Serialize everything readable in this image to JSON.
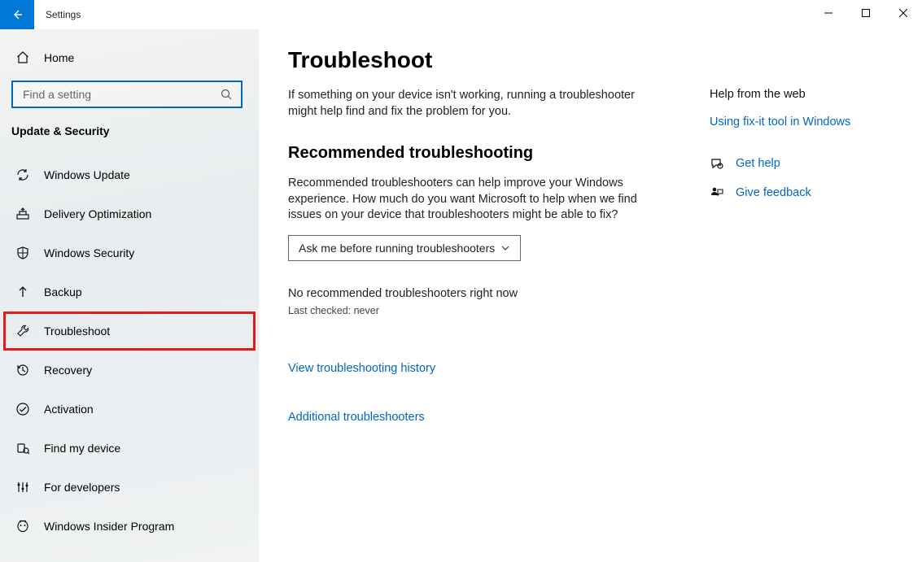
{
  "titlebar": {
    "title": "Settings"
  },
  "sidebar": {
    "home_label": "Home",
    "search_placeholder": "Find a setting",
    "category": "Update & Security",
    "items": [
      {
        "label": "Windows Update"
      },
      {
        "label": "Delivery Optimization"
      },
      {
        "label": "Windows Security"
      },
      {
        "label": "Backup"
      },
      {
        "label": "Troubleshoot"
      },
      {
        "label": "Recovery"
      },
      {
        "label": "Activation"
      },
      {
        "label": "Find my device"
      },
      {
        "label": "For developers"
      },
      {
        "label": "Windows Insider Program"
      }
    ]
  },
  "main": {
    "title": "Troubleshoot",
    "intro": "If something on your device isn't working, running a troubleshooter might help find and fix the problem for you.",
    "rec_heading": "Recommended troubleshooting",
    "rec_text": "Recommended troubleshooters can help improve your Windows experience. How much do you want Microsoft to help when we find issues on your device that troubleshooters might be able to fix?",
    "dropdown_value": "Ask me before running troubleshooters",
    "no_recommended": "No recommended troubleshooters right now",
    "last_checked": "Last checked: never",
    "history_link": "View troubleshooting history",
    "additional_link": "Additional troubleshooters"
  },
  "right": {
    "help_from_web": "Help from the web",
    "fixit_link": "Using fix-it tool in Windows",
    "get_help": "Get help",
    "give_feedback": "Give feedback"
  }
}
